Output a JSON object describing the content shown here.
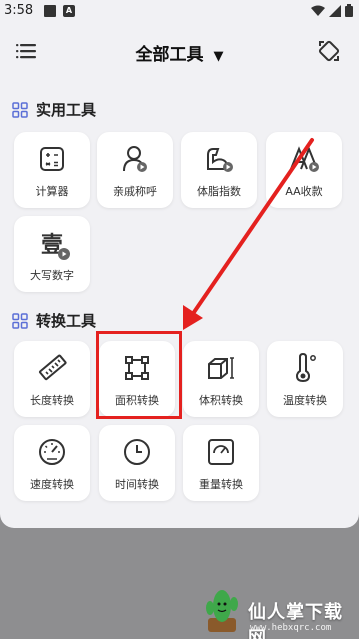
{
  "status_bar": {
    "time": "3:58",
    "a_icon_text": "A"
  },
  "header": {
    "title": "全部工具",
    "dropdown_glyph": "▼"
  },
  "sections": [
    {
      "title": "实用工具",
      "tools": [
        {
          "label": "计算器",
          "icon": "calculator-icon"
        },
        {
          "label": "亲戚称呼",
          "icon": "person-icon"
        },
        {
          "label": "体脂指数",
          "icon": "muscle-icon"
        },
        {
          "label": "AA收款",
          "icon": "aa-icon"
        },
        {
          "label": "大写数字",
          "icon": "chinese-numeral-icon",
          "glyph": "壹"
        }
      ]
    },
    {
      "title": "转换工具",
      "tools": [
        {
          "label": "长度转换",
          "icon": "ruler-icon"
        },
        {
          "label": "面积转换",
          "icon": "area-square-icon"
        },
        {
          "label": "体积转换",
          "icon": "cube-icon"
        },
        {
          "label": "温度转换",
          "icon": "thermometer-icon"
        },
        {
          "label": "速度转换",
          "icon": "speedometer-icon"
        },
        {
          "label": "时间转换",
          "icon": "clock-icon"
        },
        {
          "label": "重量转换",
          "icon": "scale-icon"
        }
      ]
    }
  ],
  "annotation": {
    "color": "#e4211f",
    "highlighted_tool": "面积转换"
  },
  "watermark": {
    "title": "仙人掌下载网",
    "url": "www.hebxqrc.com"
  },
  "colors": {
    "screen_bg": "#f1f1f4",
    "card_bg": "#ffffff",
    "icon_color": "#333333",
    "accent_blue": "#5b6fd6"
  }
}
